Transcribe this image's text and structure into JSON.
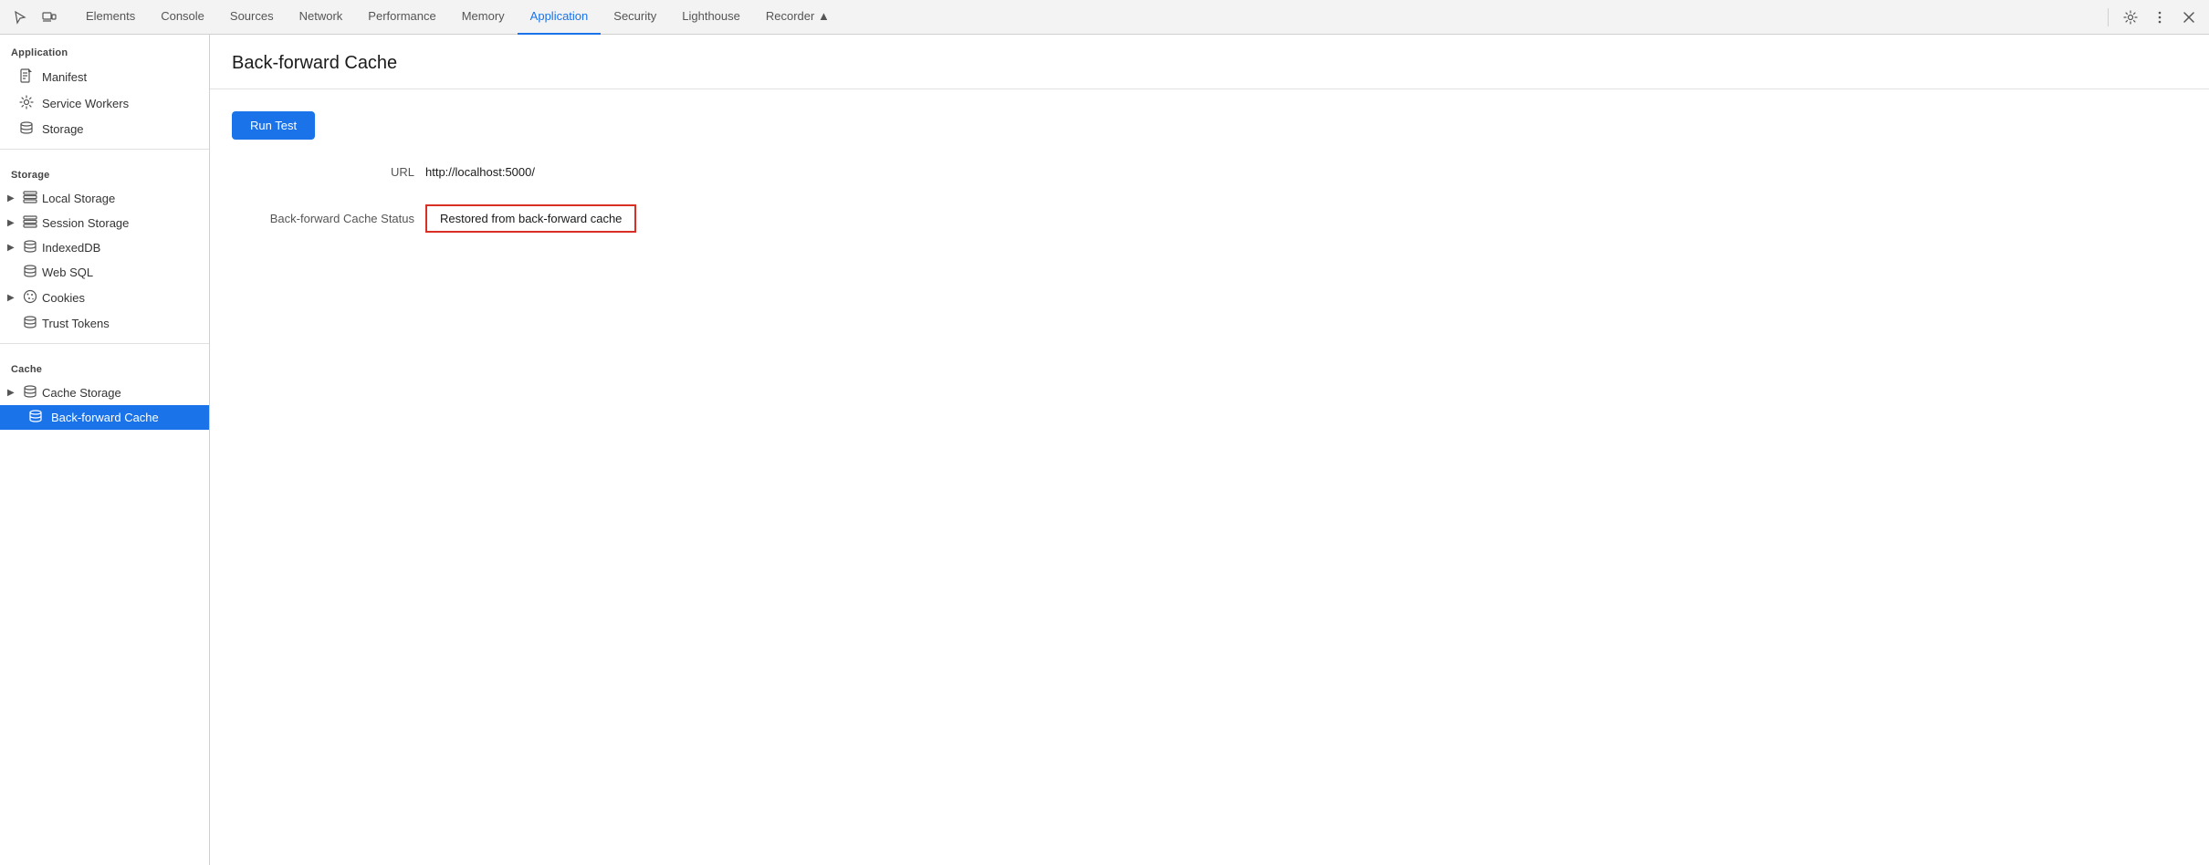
{
  "tabs": {
    "items": [
      {
        "label": "Elements",
        "active": false
      },
      {
        "label": "Console",
        "active": false
      },
      {
        "label": "Sources",
        "active": false
      },
      {
        "label": "Network",
        "active": false
      },
      {
        "label": "Performance",
        "active": false
      },
      {
        "label": "Memory",
        "active": false
      },
      {
        "label": "Application",
        "active": true
      },
      {
        "label": "Security",
        "active": false
      },
      {
        "label": "Lighthouse",
        "active": false
      },
      {
        "label": "Recorder ▲",
        "active": false
      }
    ]
  },
  "sidebar": {
    "application_section": "Application",
    "application_items": [
      {
        "label": "Manifest",
        "icon": "manifest"
      },
      {
        "label": "Service Workers",
        "icon": "gear"
      },
      {
        "label": "Storage",
        "icon": "storage"
      }
    ],
    "storage_section": "Storage",
    "storage_items": [
      {
        "label": "Local Storage",
        "has_arrow": true
      },
      {
        "label": "Session Storage",
        "has_arrow": true
      },
      {
        "label": "IndexedDB",
        "has_arrow": true
      },
      {
        "label": "Web SQL",
        "has_arrow": false
      },
      {
        "label": "Cookies",
        "has_arrow": true
      },
      {
        "label": "Trust Tokens",
        "has_arrow": false
      }
    ],
    "cache_section": "Cache",
    "cache_items": [
      {
        "label": "Cache Storage",
        "has_arrow": true,
        "active": false
      },
      {
        "label": "Back-forward Cache",
        "has_arrow": false,
        "active": true
      }
    ]
  },
  "content": {
    "title": "Back-forward Cache",
    "run_test_label": "Run Test",
    "url_label": "URL",
    "url_value": "http://localhost:5000/",
    "cache_status_label": "Back-forward Cache Status",
    "cache_status_value": "Restored from back-forward cache"
  }
}
